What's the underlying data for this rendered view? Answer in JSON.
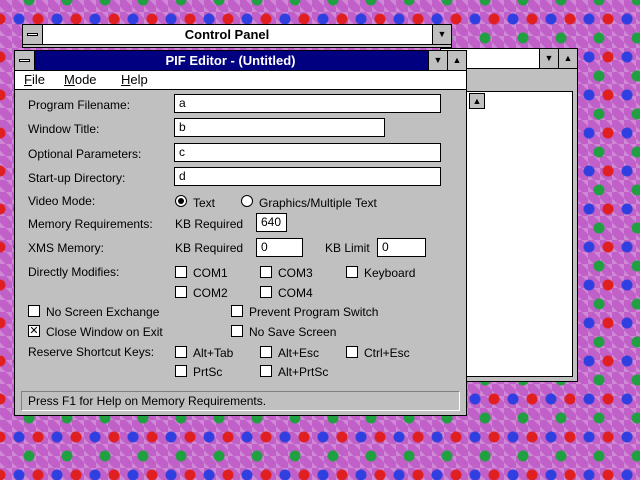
{
  "control_panel": {
    "title": "Control Panel",
    "minimize_icon": "down-arrow"
  },
  "back_window": {
    "minimize_icon": "down-arrow",
    "maximize_icon": "up-arrow"
  },
  "pif_editor": {
    "title": "PIF Editor - (Untitled)",
    "menu": {
      "file": "File",
      "mode": "Mode",
      "help": "Help"
    },
    "fields": {
      "program_filename": {
        "label": "Program Filename:",
        "value": "a"
      },
      "window_title": {
        "label": "Window Title:",
        "value": "b"
      },
      "optional_parameters": {
        "label": "Optional Parameters:",
        "value": "c"
      },
      "startup_directory": {
        "label": "Start-up Directory:",
        "value": "d"
      }
    },
    "video_mode": {
      "label": "Video Mode:",
      "text": "Text",
      "graphics": "Graphics/Multiple Text",
      "selected": "Text"
    },
    "memory": {
      "label": "Memory Requirements:",
      "kb_required": "KB Required",
      "value": "640"
    },
    "xms": {
      "label": "XMS Memory:",
      "kb_required": "KB Required",
      "required_value": "0",
      "kb_limit": "KB Limit",
      "limit_value": "0"
    },
    "directly_modifies": {
      "label": "Directly Modifies:",
      "com1": "COM1",
      "com2": "COM2",
      "com3": "COM3",
      "com4": "COM4",
      "keyboard": "Keyboard"
    },
    "options": {
      "no_screen_exchange": "No Screen Exchange",
      "prevent_program_switch": "Prevent Program Switch",
      "close_window_on_exit": "Close Window on Exit",
      "no_save_screen": "No Save Screen"
    },
    "shortcut_keys": {
      "label": "Reserve Shortcut Keys:",
      "alt_tab": "Alt+Tab",
      "alt_esc": "Alt+Esc",
      "ctrl_esc": "Ctrl+Esc",
      "prtsc": "PrtSc",
      "alt_prtsc": "Alt+PrtSc"
    },
    "status": "Press F1 for Help on Memory Requirements."
  }
}
